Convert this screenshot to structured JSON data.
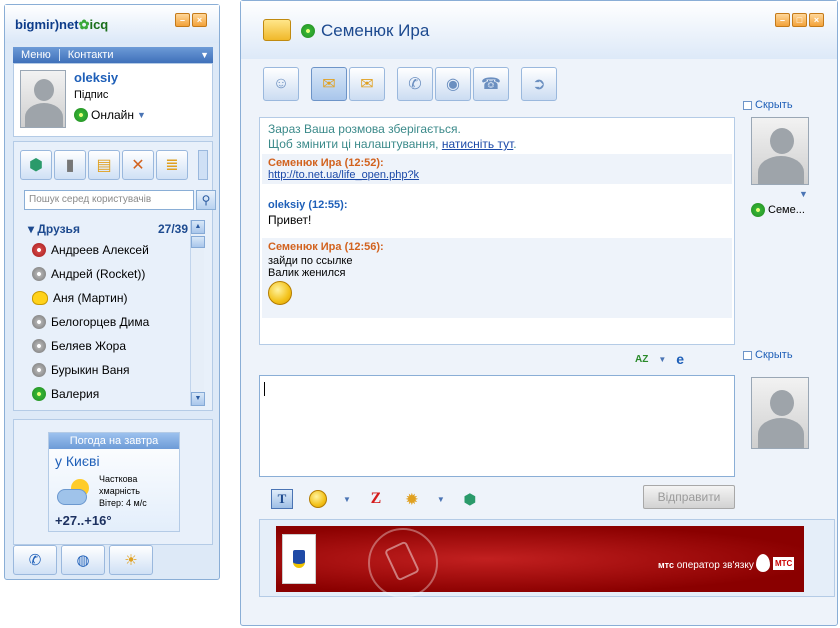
{
  "colors": {
    "accent": "#1e5fb8",
    "title_bar": "#dbe8f8",
    "them_name": "#d2621e",
    "me_name": "#1e5fb8",
    "system_note": "#3b8a8a",
    "banner_red": "#a00000",
    "window_button": "#f3a23a"
  },
  "left": {
    "logo_main": "bigmir)net",
    "logo_icq": "icq",
    "menu": {
      "item1": "Меню",
      "item2": "Контакти"
    },
    "profile": {
      "name": "oleksiy",
      "subtitle": "Підпис",
      "status": "Онлайн"
    },
    "search_placeholder": "Пошук серед користувачів",
    "group": {
      "name": "Друзья",
      "count": "27/39"
    },
    "contacts": [
      {
        "name": "Андреев Алексей",
        "icon": "red-flower-icon"
      },
      {
        "name": "Андрей (Rocket))",
        "icon": "offline-flower-icon"
      },
      {
        "name": "Аня (Мартин)",
        "icon": "duck-icon"
      },
      {
        "name": "Белогорцев Дима",
        "icon": "offline-flower-icon"
      },
      {
        "name": "Беляев Жора",
        "icon": "offline-flower-icon"
      },
      {
        "name": "Бурыкин Ваня",
        "icon": "offline-flower-icon"
      },
      {
        "name": "Валерия",
        "icon": "online-flower-icon"
      }
    ],
    "weather": {
      "header": "Погода на завтра",
      "city": "у Києві",
      "desc1": "Часткова",
      "desc2": "хмарність",
      "wind": "Вітер: 4 м/с",
      "temp": "+27..+16°"
    }
  },
  "chat": {
    "contact_name": "Семенюк Ира",
    "system_line1": "Зараз Ваша розмова зберігається.",
    "system_line2_pre": "Щоб змінити ці налаштування, ",
    "system_line2_link": "натисніть тут",
    "system_line2_post": ".",
    "messages": [
      {
        "sender": "Семенюк Ира (12:52):",
        "text": "http://to.net.ua/life_open.php?k",
        "is_link": true
      },
      {
        "sender": "oleksiy (12:55):",
        "text": "Привет!"
      },
      {
        "sender": "Семенюк Ира (12:56):",
        "text1": "зайди по ссылке",
        "text2": "Валик женился"
      }
    ],
    "hide_label_top": "Скрыть",
    "hide_label_bottom": "Скрыть",
    "side_contact_name": "Семе...",
    "spell_label": "AZ",
    "send_label": "Відправити",
    "banner": {
      "operator_brand": "мтс",
      "operator_text": "оператор зв'язку",
      "logo_label": "МТС"
    }
  }
}
